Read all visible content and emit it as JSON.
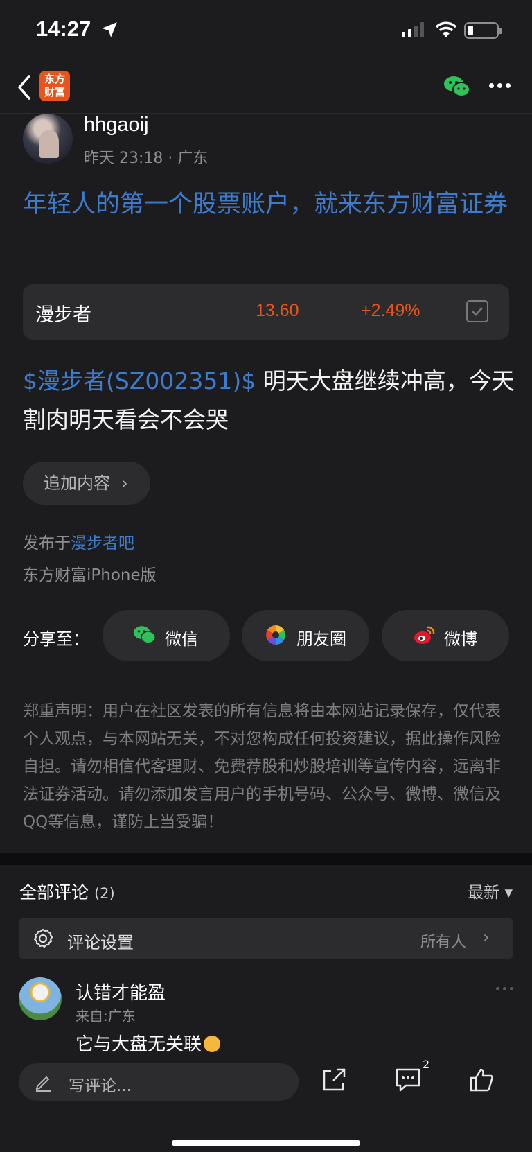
{
  "status_bar": {
    "time": "14:27"
  },
  "nav": {
    "logo_line1": "东方",
    "logo_line2": "财富"
  },
  "author": {
    "name": "hhgaoij",
    "meta": "昨天 23:18 · 广东"
  },
  "post": {
    "title": "年轻人的第一个股票账户，就来东方财富证券",
    "stock": {
      "name": "漫步者",
      "price": "13.60",
      "change": "+2.49%"
    },
    "body_tag": "$漫步者(SZ002351)$",
    "body_text": "  明天大盘继续冲高，今天割肉明天看会不会哭",
    "append_label": "追加内容",
    "publish_prefix": "发布于",
    "publish_bar": "漫步者吧",
    "client": "东方财富iPhone版"
  },
  "share": {
    "label": "分享至：",
    "wechat": "微信",
    "moments": "朋友圈",
    "weibo": "微博"
  },
  "disclaimer": "郑重声明：用户在社区发表的所有信息将由本网站记录保存，仅代表个人观点，与本网站无关，不对您构成任何投资建议，据此操作风险自担。请勿相信代客理财、免费荐股和炒股培训等宣传内容，远离非法证券活动。请勿添加发言用户的手机号码、公众号、微博、微信及QQ等信息，谨防上当受骗！",
  "comments": {
    "title": "全部评论",
    "count": "(2)",
    "sort": "最新 ▾",
    "settings_label": "评论设置",
    "settings_value": "所有人",
    "items": [
      {
        "name": "认错才能盈",
        "from": "来自:广东",
        "text": "它与大盘无关联"
      }
    ]
  },
  "bottom_bar": {
    "write_placeholder": "写评论...",
    "comment_badge": "2"
  },
  "colors": {
    "accent_blue": "#3d7ccd",
    "stock_red": "#e8541c",
    "background": "#1c1c1e",
    "card": "#2c2c2e"
  }
}
